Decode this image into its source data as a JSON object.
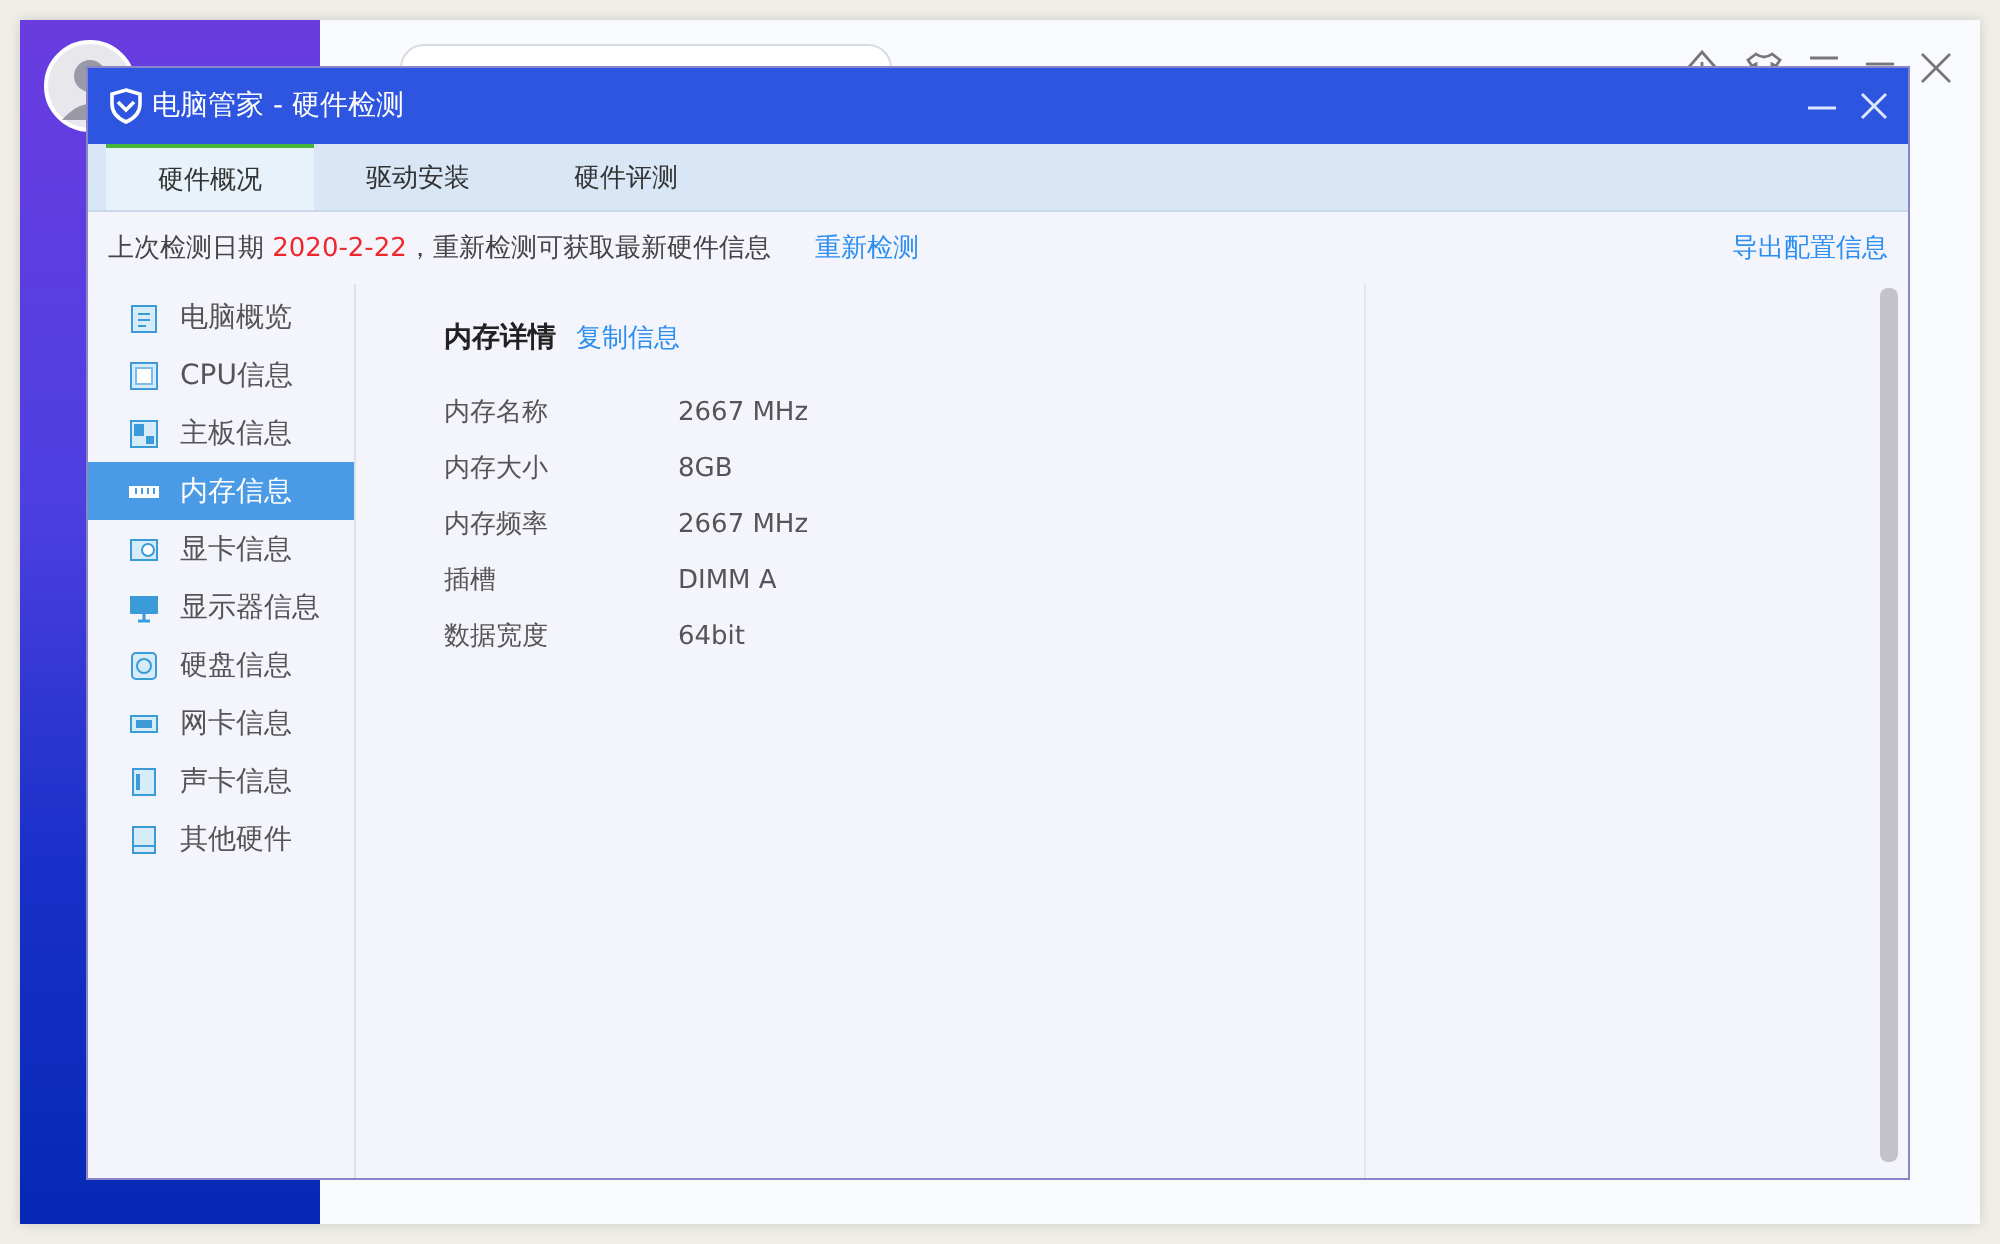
{
  "window": {
    "title": "电脑管家 - 硬件检测"
  },
  "tabs": [
    {
      "label": "硬件概况",
      "selected": true
    },
    {
      "label": "驱动安装",
      "selected": false
    },
    {
      "label": "硬件评测",
      "selected": false
    }
  ],
  "notice": {
    "prefix": "上次检测日期",
    "date": "2020-2-22",
    "suffix": "，重新检测可获取最新硬件信息",
    "rescan_link": "重新检测",
    "export_link": "导出配置信息"
  },
  "sidebar": {
    "items": [
      {
        "label": "电脑概览",
        "kind": "overview",
        "selected": false
      },
      {
        "label": "CPU信息",
        "kind": "cpu",
        "selected": false
      },
      {
        "label": "主板信息",
        "kind": "board",
        "selected": false
      },
      {
        "label": "内存信息",
        "kind": "memory",
        "selected": true
      },
      {
        "label": "显卡信息",
        "kind": "gpu",
        "selected": false
      },
      {
        "label": "显示器信息",
        "kind": "monitor",
        "selected": false
      },
      {
        "label": "硬盘信息",
        "kind": "disk",
        "selected": false
      },
      {
        "label": "网卡信息",
        "kind": "nic",
        "selected": false
      },
      {
        "label": "声卡信息",
        "kind": "sound",
        "selected": false
      },
      {
        "label": "其他硬件",
        "kind": "other",
        "selected": false
      }
    ]
  },
  "details": {
    "title": "内存详情",
    "copy_link": "复制信息",
    "rows": [
      {
        "label": "内存名称",
        "value": "2667 MHz"
      },
      {
        "label": "内存大小",
        "value": "8GB"
      },
      {
        "label": "内存频率",
        "value": "2667 MHz"
      },
      {
        "label": "插槽",
        "value": "DIMM A"
      },
      {
        "label": "数据宽度",
        "value": "64bit"
      }
    ]
  }
}
